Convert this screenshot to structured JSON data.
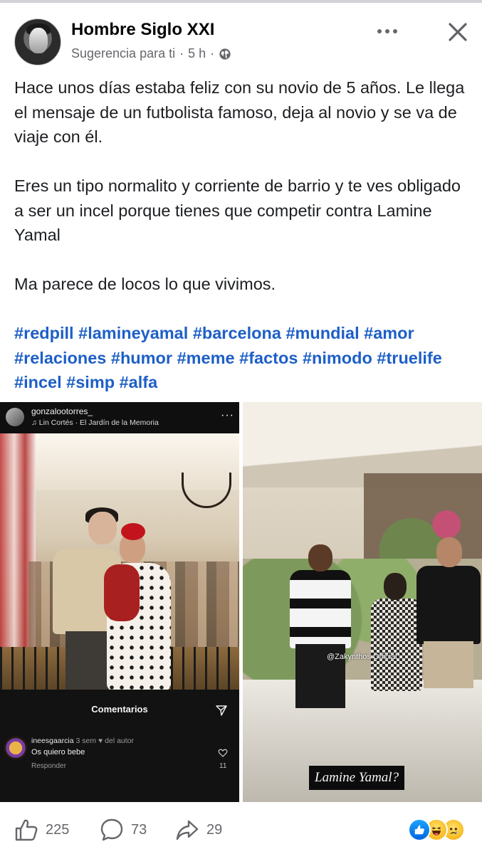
{
  "post": {
    "page_name": "Hombre Siglo XXI",
    "suggestion": "Sugerencia para ti",
    "separator": "·",
    "time": "5 h",
    "paragraphs": [
      "Hace unos días estaba feliz con su novio de 5 años. Le llega el mensaje de un futbolista famoso, deja al novio y se va de viaje con él.",
      "Eres un tipo normalito y corriente de barrio y te ves obligado a ser un incel porque tienes que competir contra Lamine Yamal",
      "Ma parece de locos lo que vivimos."
    ],
    "hashtags": [
      "#redpill",
      "#lamineyamal",
      "#barcelona",
      "#mundial",
      "#amor",
      "#relaciones",
      "#humor",
      "#meme",
      "#factos",
      "#nimodo",
      "#truelife",
      "#incel",
      "#simp",
      "#alfa"
    ],
    "icons": {
      "more": "more-horizontal-icon",
      "close": "close-icon",
      "audience": "globe-icon"
    }
  },
  "left_image": {
    "username": "gonzalootorres_",
    "song": "♫ Lin Cortés · El Jardín de la Memoria",
    "more": "···",
    "comments_title": "Comentarios",
    "comment": {
      "user": "ineesgaarcia",
      "age": "3 sem",
      "author_badge": "♥ del autor",
      "text": "Os quiero bebe",
      "reply": "Responder",
      "likes": "11"
    }
  },
  "right_image": {
    "watermark": "@Zakynthos Official",
    "caption": "Lamine Yamal?"
  },
  "footer": {
    "likes": "225",
    "comments": "73",
    "shares": "29",
    "reactions": [
      "like",
      "haha",
      "sad"
    ]
  },
  "colors": {
    "hashtag": "#1d5fc7",
    "secondary_text": "#65676b",
    "like_blue": "#0866ff"
  }
}
